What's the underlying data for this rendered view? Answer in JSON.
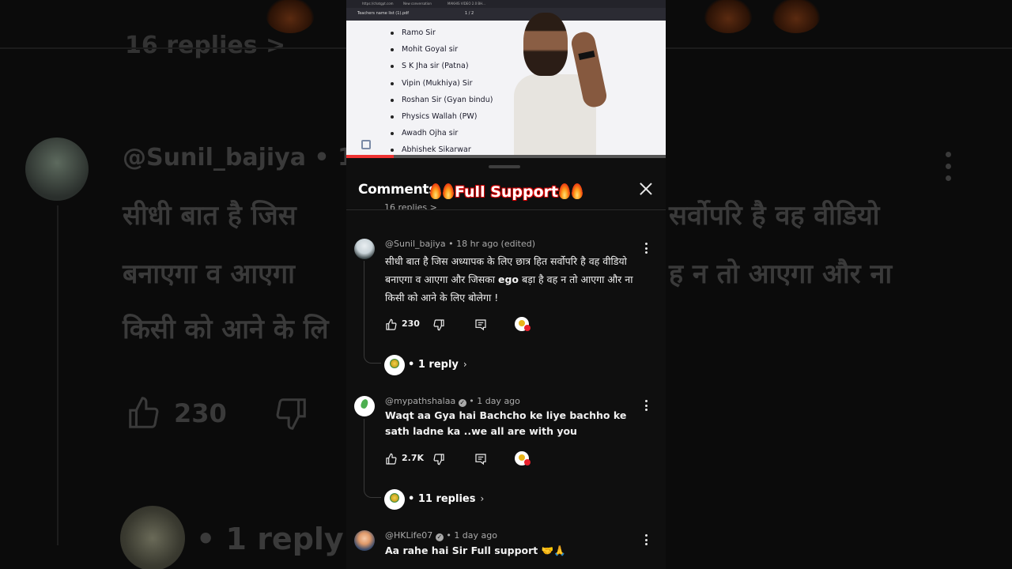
{
  "background": {
    "top_text": "16 replies >",
    "username": "@Sunil_bajiya • 1",
    "line1_left": "सीधी बात है जिस",
    "line1_right": "सर्वोपरि है वह वीडियो",
    "line2_left": "बनाएगा व आएगा",
    "line2_right": "ह न तो आएगा और ना",
    "line3_left": "किसी को आने के लि",
    "likes": "230",
    "reply_text": "• 1 reply"
  },
  "video": {
    "pdf_title": "Teachers name list (1).pdf",
    "pdf_page": "1 / 2",
    "tab_1": "https://chatgpt.com",
    "tab_2": "New conversation",
    "tab_3": "MAKHIS VIDEO 2.0 BH...",
    "teachers": [
      "Ramo Sir",
      "Mohit Goyal sir",
      "S K Jha sir (Patna)",
      "Vipin (Mukhiya) Sir",
      "Roshan Sir (Gyan bindu)",
      "Physics Wallah (PW)",
      "Awadh Ojha sir",
      "Abhishek Sikarwar"
    ]
  },
  "panel": {
    "title": "Comments",
    "overlay_text": "Full Support",
    "peek_text": "16 replies >"
  },
  "comments": [
    {
      "author": "@Sunil_bajiya",
      "time": "18 hr ago (edited)",
      "text_pre": "सीधी बात है जिस अध्यापक के लिए छात्र हित सर्वोपरि है वह वीडियो बनाएगा व आएगा और जिसका",
      "text_bold": "ego",
      "text_post": "बड़ा है वह न तो आएगा और ना किसी को आने के लिए बोलेगा !",
      "likes": "230",
      "replies": "• 1 reply"
    },
    {
      "author": "@mypathshalaa",
      "time": "1 day ago",
      "text": "Waqt aa Gya hai Bachcho ke liye bachho ke sath ladne ka ..we all are with you",
      "likes": "2.7K",
      "replies": "• 11 replies"
    },
    {
      "author": "@HKLife07",
      "time": "1 day ago",
      "text": "Aa rahe hai Sir Full support 🤝🙏"
    }
  ],
  "glyphs": {
    "verified": "✓",
    "chevron": "›",
    "separator": "•"
  },
  "icons": [
    "like-icon",
    "dislike-icon",
    "reply-icon",
    "more-vert-icon",
    "close-icon",
    "verified-icon",
    "fire-icon"
  ]
}
